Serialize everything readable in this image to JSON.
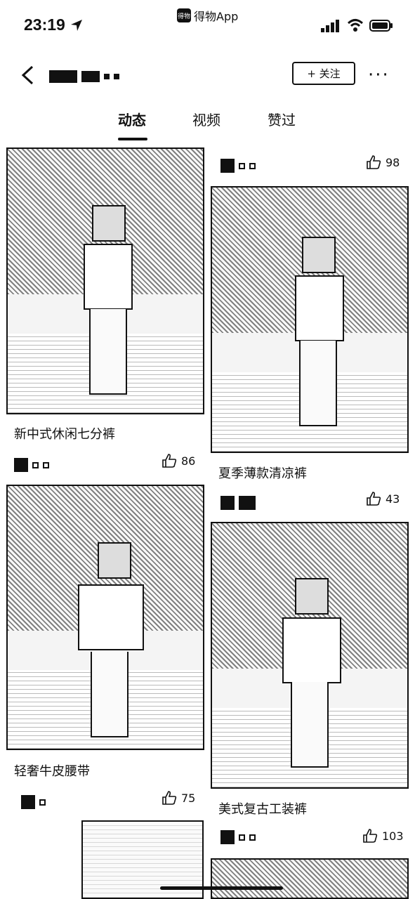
{
  "status_bar": {
    "time": "23:19",
    "center_app_label": "得物App",
    "app_logo_text": "得物"
  },
  "header": {
    "follow_label": "+ 关注",
    "more_label": "···"
  },
  "tabs": [
    {
      "label": "动态",
      "active": true
    },
    {
      "label": "视频",
      "active": false
    },
    {
      "label": "赞过",
      "active": false
    }
  ],
  "posts": [
    {
      "title": "新中式休闲七分裤",
      "likes": "86"
    },
    {
      "title": "夏季薄款清凉裤",
      "likes": "98"
    },
    {
      "title": "轻奢牛皮腰带",
      "likes": "75"
    },
    {
      "title": "美式复古工装裤",
      "likes": "43"
    },
    {
      "title": "",
      "likes": "103"
    }
  ],
  "colors": {
    "ink": "#111111",
    "background": "#ffffff"
  }
}
